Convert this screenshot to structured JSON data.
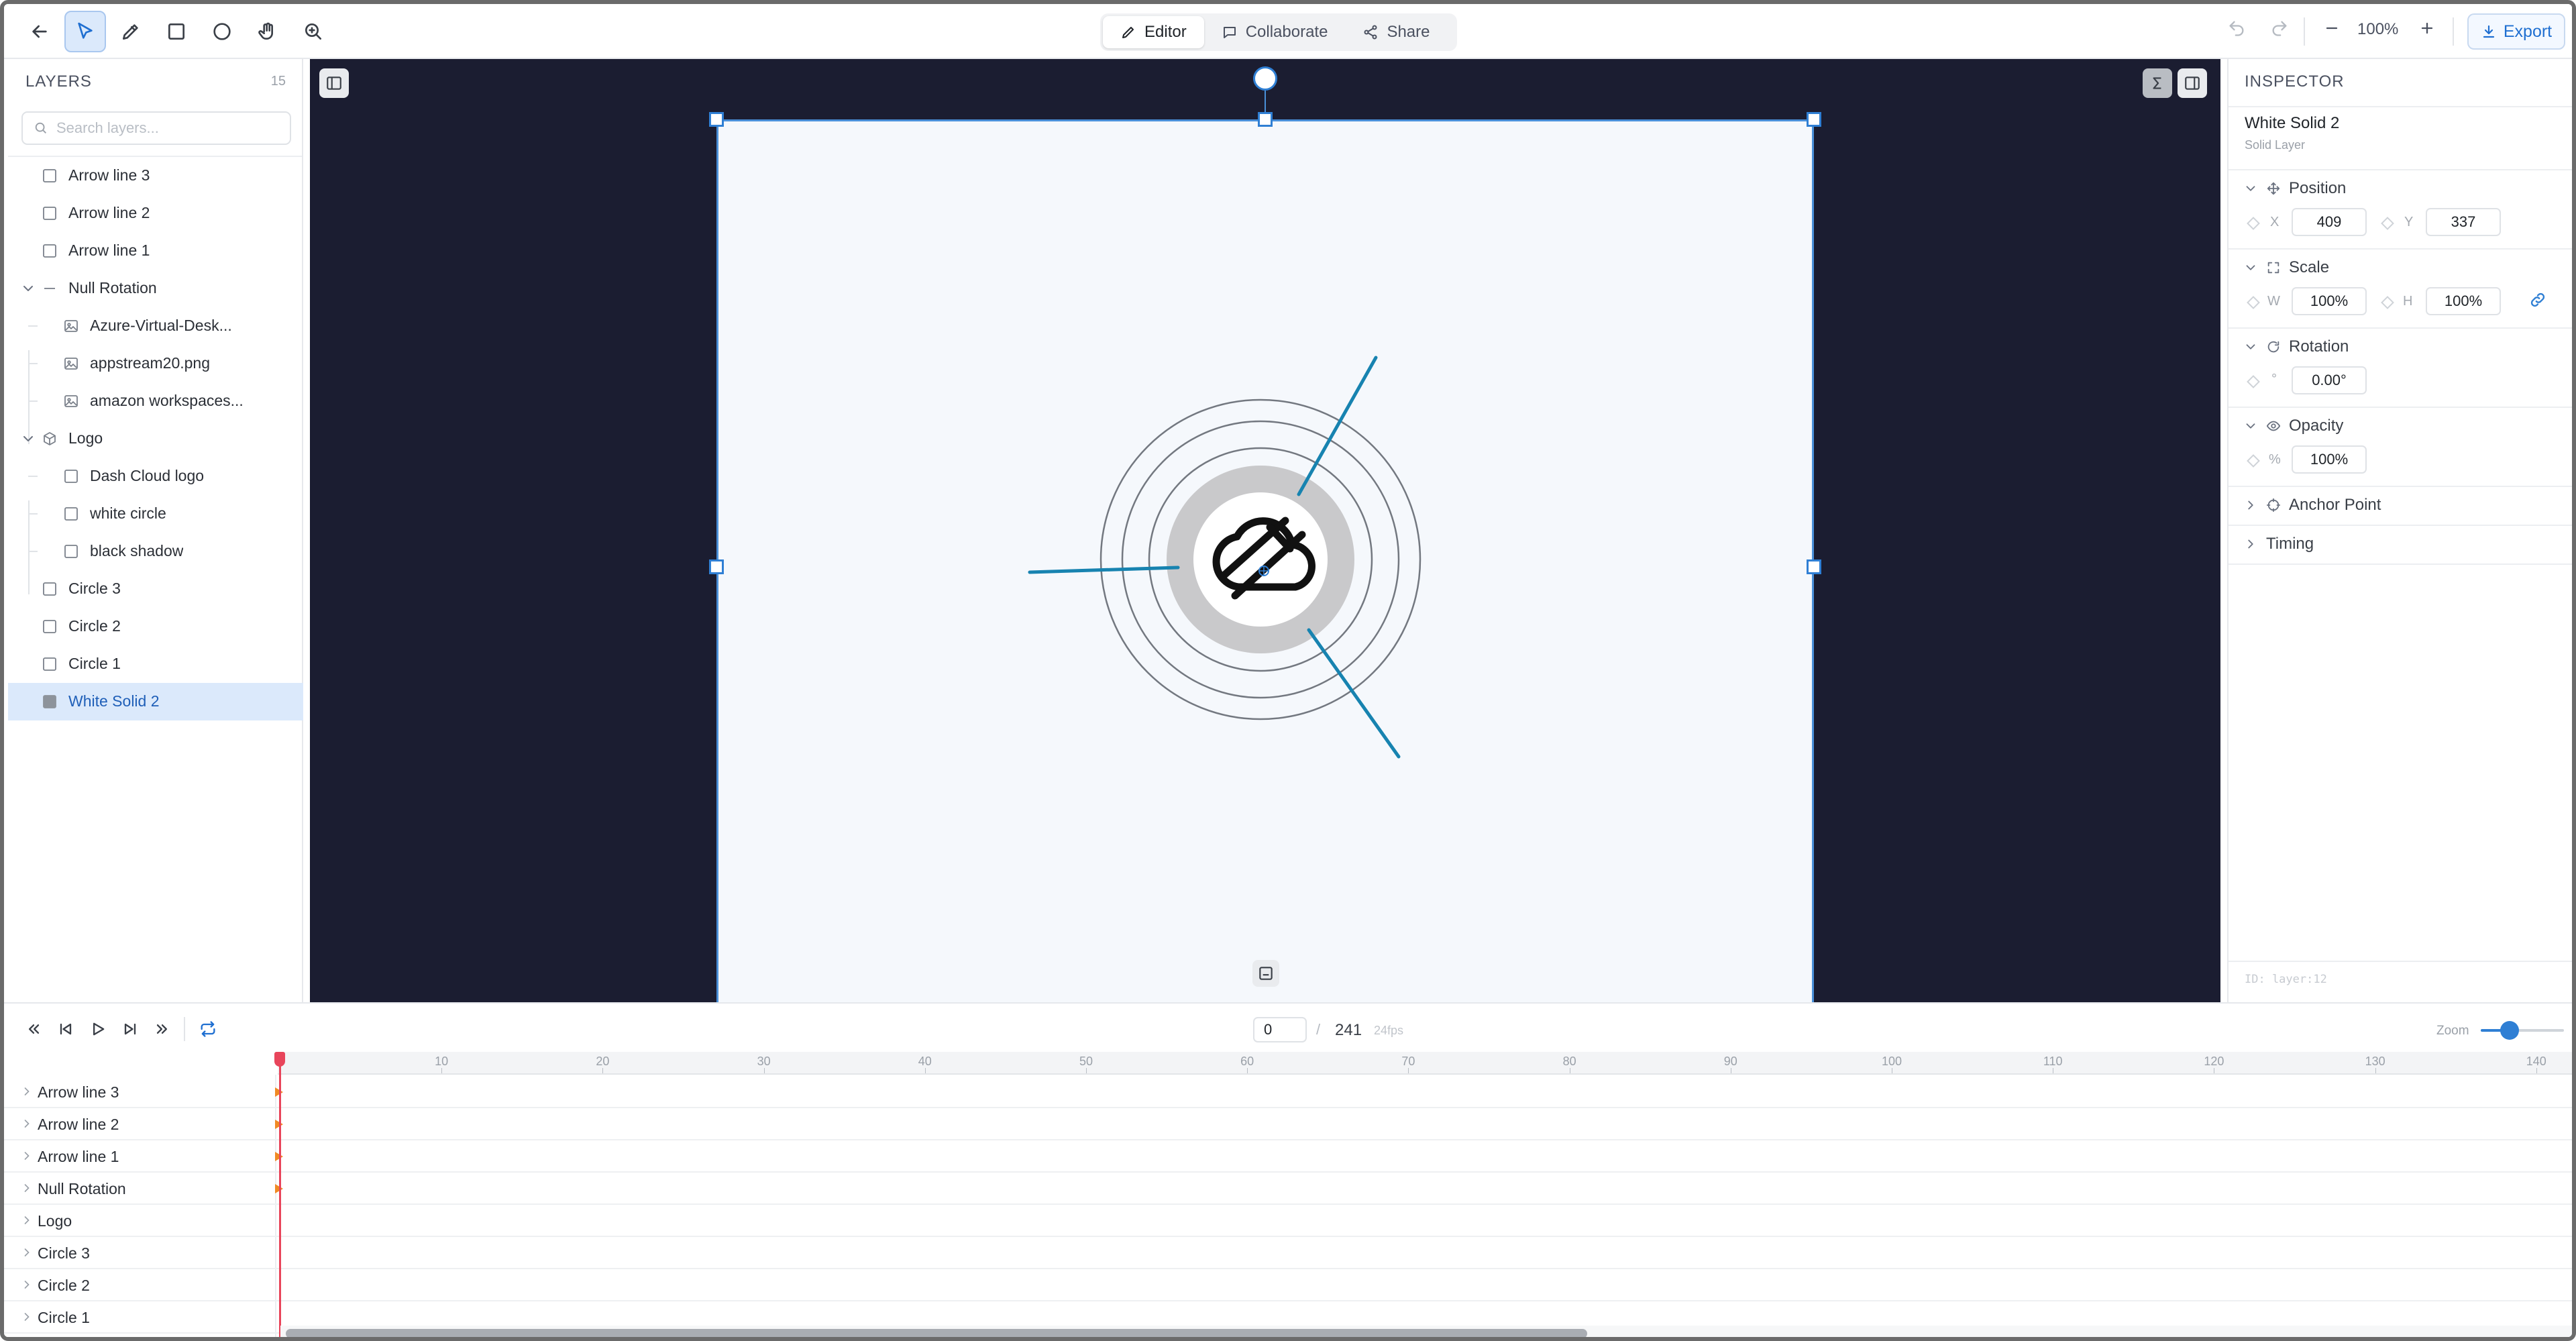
{
  "toolbar": {
    "modes": [
      {
        "label": "Editor",
        "icon": "pencil-icon",
        "active": true
      },
      {
        "label": "Collaborate",
        "icon": "comment-icon",
        "active": false
      },
      {
        "label": "Share",
        "icon": "share-icon",
        "active": false
      }
    ],
    "zoom": "100%",
    "export_label": "Export",
    "tools": [
      "back-arrow-icon",
      "select-pointer-icon",
      "pen-icon",
      "rectangle-icon",
      "ellipse-icon",
      "hand-icon",
      "zoom-in-icon"
    ]
  },
  "layers": {
    "title": "LAYERS",
    "count": "15",
    "search_placeholder": "Search layers...",
    "items": [
      {
        "label": "Arrow line 3"
      },
      {
        "label": "Arrow line 2"
      },
      {
        "label": "Arrow line 1"
      },
      {
        "label": "Null Rotation"
      },
      {
        "label": "Azure-Virtual-Desk..."
      },
      {
        "label": "appstream20.png"
      },
      {
        "label": "amazon workspaces..."
      },
      {
        "label": "Logo"
      },
      {
        "label": "Dash Cloud logo"
      },
      {
        "label": "white circle"
      },
      {
        "label": "black shadow"
      },
      {
        "label": "Circle 3"
      },
      {
        "label": "Circle 2"
      },
      {
        "label": "Circle 1"
      },
      {
        "label": "White Solid 2"
      }
    ]
  },
  "inspector": {
    "title": "INSPECTOR",
    "layer_name": "White Solid 2",
    "layer_type": "Solid Layer",
    "position": {
      "label": "Position",
      "x_label": "X",
      "x": "409",
      "y_label": "Y",
      "y": "337"
    },
    "scale": {
      "label": "Scale",
      "w_label": "W",
      "w": "100%",
      "h_label": "H",
      "h": "100%"
    },
    "rotation": {
      "label": "Rotation",
      "unit": "°",
      "value": "0.00°"
    },
    "opacity": {
      "label": "Opacity",
      "unit": "%",
      "value": "100%"
    },
    "anchor_label": "Anchor Point",
    "timing_label": "Timing",
    "layer_id": "ID: layer:12"
  },
  "timeline": {
    "current_frame": "0",
    "separator": "/",
    "total_frames": "241",
    "fps": "24fps",
    "zoom_label": "Zoom",
    "zoom_level": 0.35,
    "ticks": [
      "10",
      "20",
      "30",
      "40",
      "50",
      "60",
      "70",
      "80",
      "90",
      "100",
      "110",
      "120",
      "130",
      "140"
    ],
    "rows": [
      {
        "label": "Arrow line 3",
        "keyframe": true
      },
      {
        "label": "Arrow line 2",
        "keyframe": true
      },
      {
        "label": "Arrow line 1",
        "keyframe": true
      },
      {
        "label": "Null Rotation",
        "keyframe": true
      },
      {
        "label": "Logo",
        "keyframe": false
      },
      {
        "label": "Circle 3",
        "keyframe": false
      },
      {
        "label": "Circle 2",
        "keyframe": false
      },
      {
        "label": "Circle 1",
        "keyframe": false
      }
    ]
  },
  "colors": {
    "accent": "#2f7fd4",
    "canvas_bg": "#1b1d31",
    "artboard_bg": "#f5f8fc",
    "arrow_line": "#1783b0",
    "playhead": "#e8455b",
    "keyframe": "#f08a24"
  }
}
